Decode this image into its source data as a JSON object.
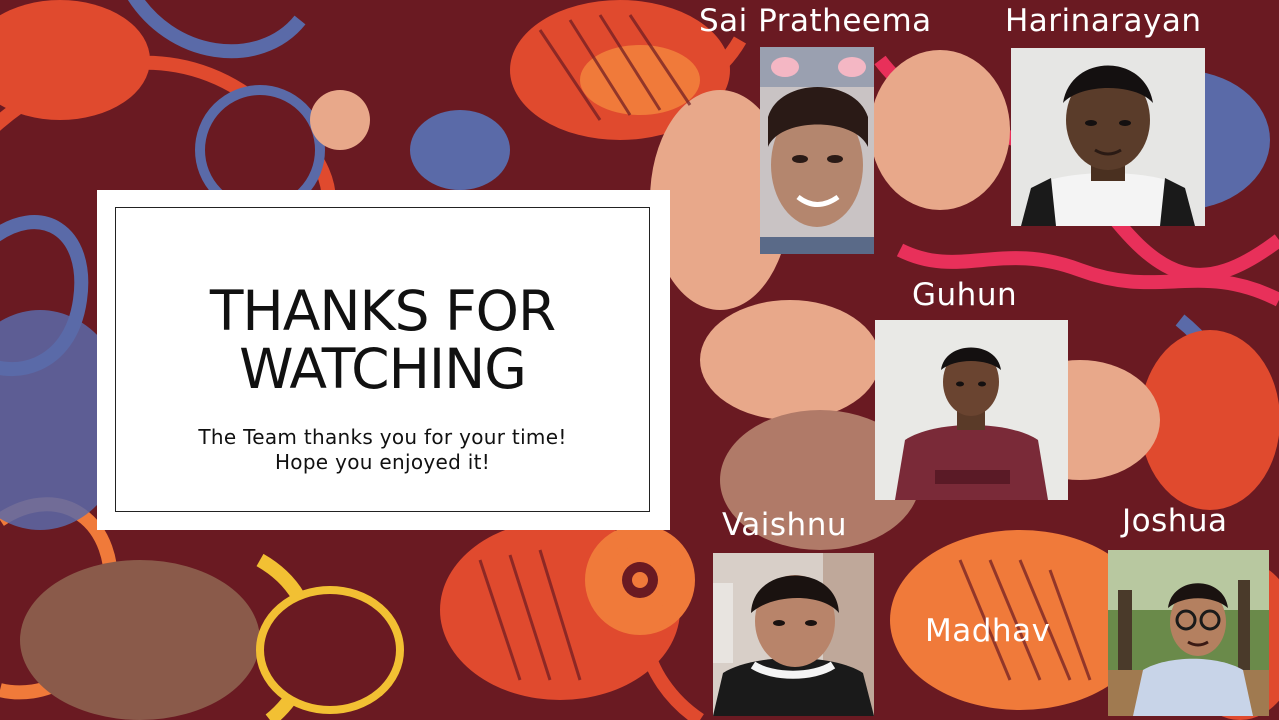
{
  "slide": {
    "title_line1": "THANKS FOR",
    "title_line2": "WATCHING",
    "subtitle_line1": "The Team thanks you for your time!",
    "subtitle_line2": "Hope you enjoyed it!"
  },
  "team": [
    {
      "name": "Sai Pratheema",
      "photo": "person-photo"
    },
    {
      "name": "Harinarayan",
      "photo": "person-photo"
    },
    {
      "name": "Guhun",
      "photo": "person-photo"
    },
    {
      "name": "Vaishnu",
      "photo": "person-photo"
    },
    {
      "name": "Joshua",
      "photo": "person-photo"
    },
    {
      "name": "Madhav"
    }
  ],
  "colors": {
    "background": "#6a1a22",
    "pattern_red": "#e04a2e",
    "pattern_orange": "#f07a3a",
    "pattern_peach": "#e8a88a",
    "pattern_blue": "#5a6aa8",
    "pattern_pink": "#e8305a",
    "pattern_yellow": "#f2c033",
    "card": "#ffffff",
    "name_text": "#ffffff"
  }
}
